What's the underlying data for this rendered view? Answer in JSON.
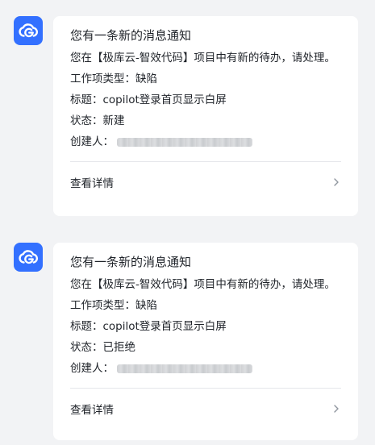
{
  "colors": {
    "accent": "#3370ff",
    "background": "#f2f3f5",
    "card": "#ffffff",
    "text": "#1f2329"
  },
  "avatar_icon": "cloud-g-icon",
  "messages": [
    {
      "title": "您有一条新的消息通知",
      "description": "您在【极库云-智效代码】项目中有新的待办，请处理。",
      "fields": {
        "type": "工作项类型：缺陷",
        "subject": "标题：copilot登录首页显示白屏",
        "status": "状态：新建",
        "creator_label": "创建人："
      },
      "action": "查看详情"
    },
    {
      "title": "您有一条新的消息通知",
      "description": "您在【极库云-智效代码】项目中有新的待办，请处理。",
      "fields": {
        "type": "工作项类型：缺陷",
        "subject": "标题：copilot登录首页显示白屏",
        "status": "状态：已拒绝",
        "creator_label": "创建人："
      },
      "action": "查看详情"
    }
  ]
}
